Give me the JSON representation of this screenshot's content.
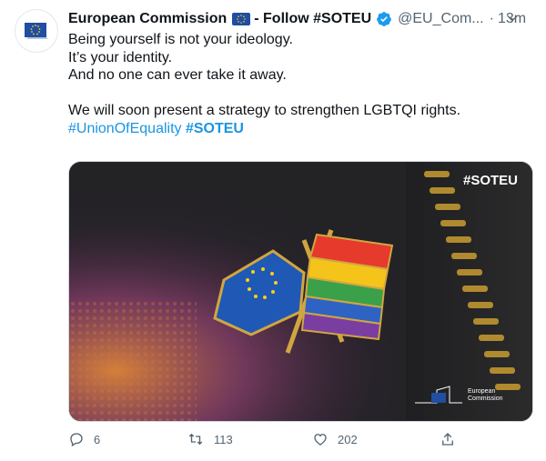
{
  "tweet": {
    "author_name": "European Commission",
    "follow_text": "- Follow #SOTEU",
    "handle": "@EU_Com...",
    "separator": "·",
    "time": "13m",
    "lines": [
      "Being yourself is not your ideology.",
      "It’s your identity.",
      "And no one can ever take it away.",
      "We will soon present a strategy to strengthen LGBTQI rights."
    ],
    "hashtag_1": "#UnionOfEquality",
    "hashtag_2": "#SOTEU"
  },
  "media": {
    "overlay_tag": "#SOTEU",
    "logo_line_1": "European",
    "logo_line_2": "Commission"
  },
  "actions": {
    "reply_count": "6",
    "retweet_count": "113",
    "like_count": "202"
  },
  "colors": {
    "link": "#1b95e0",
    "verified": "#1d9bf0",
    "eu_blue": "#1f4ea3",
    "eu_gold": "#f7d117"
  },
  "icons": [
    "eu-flag-avatar-icon",
    "eu-flag-emoji-icon",
    "verified-badge-icon",
    "chevron-down-icon",
    "reply-icon",
    "retweet-icon",
    "like-icon",
    "share-icon"
  ]
}
